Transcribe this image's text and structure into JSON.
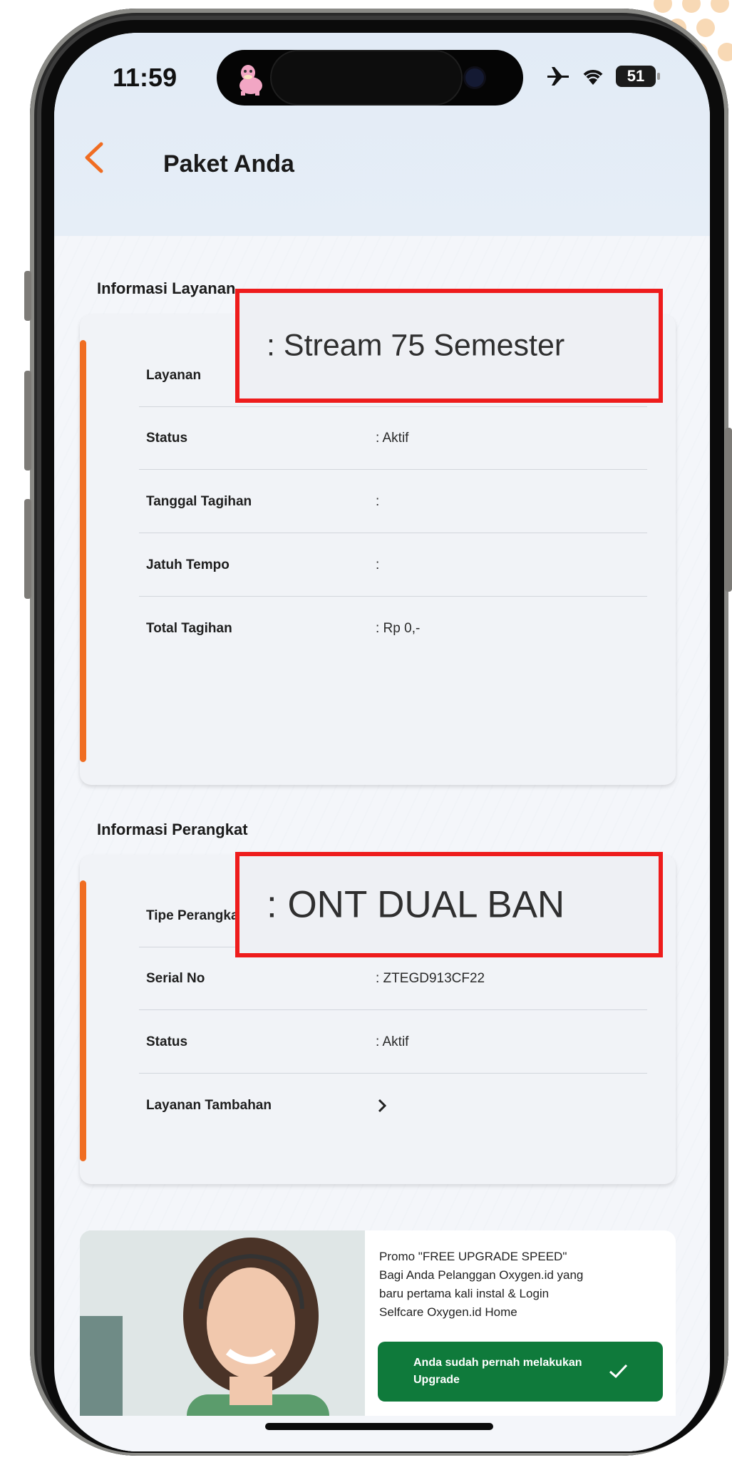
{
  "status_bar": {
    "time": "11:59",
    "battery": "51"
  },
  "header": {
    "title": "Paket Anda"
  },
  "service_section": {
    "label": "Informasi Layanan",
    "rows": [
      {
        "label": "Layanan",
        "value": ": Stream 75 Semester"
      },
      {
        "label": "Status",
        "value": ": Aktif"
      },
      {
        "label": "Tanggal Tagihan",
        "value": ":"
      },
      {
        "label": "Jatuh Tempo",
        "value": ":"
      },
      {
        "label": "Total Tagihan",
        "value": ": Rp 0,-"
      }
    ]
  },
  "device_section": {
    "label": "Informasi Perangkat",
    "rows": [
      {
        "label": "Tipe Perangkat",
        "value": ": ONT DUAL BAN"
      },
      {
        "label": "Serial No",
        "value": ": ZTEGD913CF22"
      },
      {
        "label": "Status",
        "value": ": Aktif"
      },
      {
        "label": "Layanan Tambahan",
        "value": ">"
      }
    ]
  },
  "promo": {
    "text": "Promo \"FREE UPGRADE SPEED\" Bagi Anda Pelanggan Oxygen.id yang baru pertama kali instal & Login Selfcare Oxygen.id Home",
    "button_label": "Anda sudah pernah melakukan Upgrade"
  },
  "colors": {
    "accent": "#f06d22",
    "highlight": "#ee1c1c",
    "promo_button": "#0f7a3b"
  },
  "icons": [
    "back-arrow-icon",
    "airplane-icon",
    "wifi-icon",
    "battery-icon",
    "chevron-right-icon",
    "check-icon"
  ]
}
